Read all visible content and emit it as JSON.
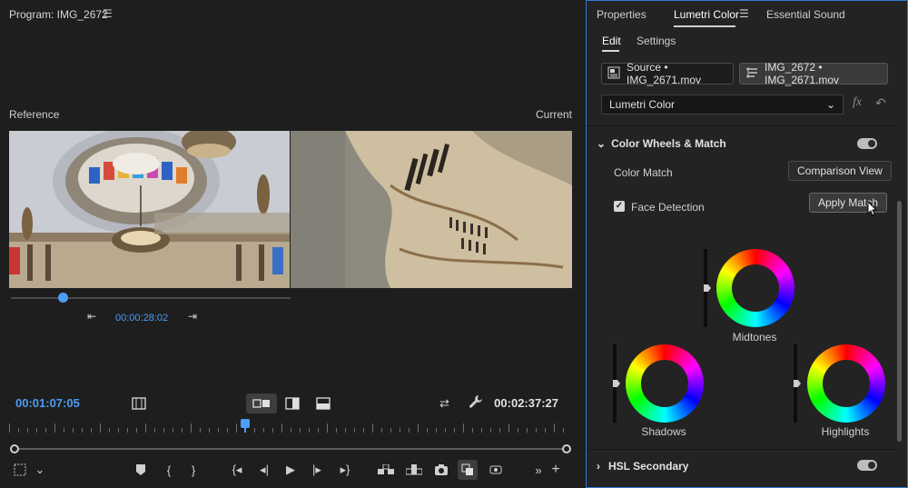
{
  "program": {
    "title": "Program: IMG_2672",
    "menu_icon": "hamburger-icon",
    "reference_label": "Reference",
    "current_label": "Current",
    "reference_timecode": "00:00:28:02",
    "reference_scrub_position": 0.19,
    "playhead_timecode": "00:01:07:05",
    "duration_timecode": "00:02:37:27",
    "playhead_position": 0.42,
    "view_modes": [
      "comparison-side-by-side-icon",
      "split-view-icon",
      "single-view-icon"
    ],
    "active_view_mode": 0
  },
  "lumetri": {
    "tabs": [
      "Properties",
      "Lumetri Color",
      "Essential Sound"
    ],
    "active_tab": "Lumetri Color",
    "subtabs": [
      "Edit",
      "Settings"
    ],
    "active_subtab": "Edit",
    "source_clip": "Source • IMG_2671.mov",
    "target_clip": "IMG_2672 • IMG_2671.mov",
    "effect_select": "Lumetri Color",
    "fx_label": "fx",
    "color_wheels": {
      "title": "Color Wheels & Match",
      "enabled": true,
      "color_match_label": "Color Match",
      "comparison_view_label": "Comparison View",
      "face_detection_label": "Face Detection",
      "face_detection_checked": true,
      "apply_match_label": "Apply Match",
      "wheels": [
        {
          "name": "Midtones",
          "level": 0.5
        },
        {
          "name": "Shadows",
          "level": 0.5
        },
        {
          "name": "Highlights",
          "level": 0.5
        }
      ]
    },
    "hsl_secondary": {
      "title": "HSL Secondary",
      "enabled": true
    }
  },
  "colors": {
    "accent": "#4c9df5",
    "panel_focus": "#2d7bd6"
  }
}
